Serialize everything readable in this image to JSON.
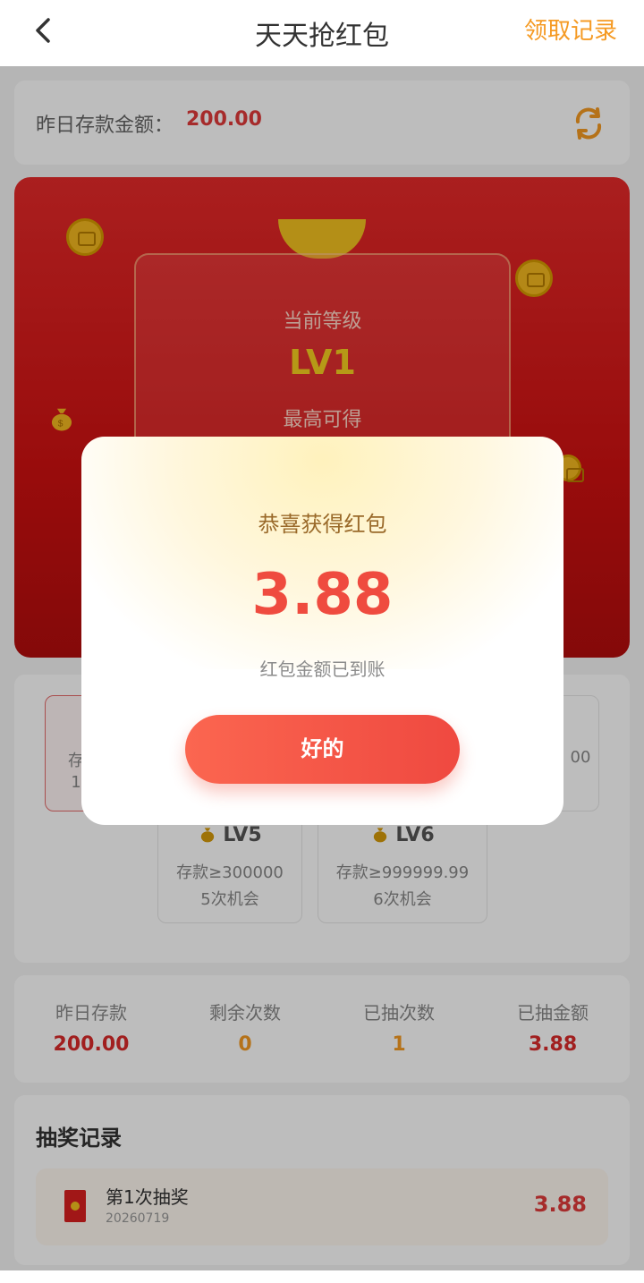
{
  "header": {
    "title": "天天抢红包",
    "record_link": "领取记录"
  },
  "deposit": {
    "label": "昨日存款金额：",
    "value": "200.00"
  },
  "current_level": {
    "caption": "当前等级",
    "value": "LV1",
    "max_label": "最高可得"
  },
  "levels": [
    {
      "name": "LV1",
      "line1": "存",
      "line2": "1"
    },
    {
      "name": "",
      "line1": "00",
      "line2": ""
    },
    {
      "name": "LV5",
      "line1": "存款≥300000",
      "line2": "5次机会"
    },
    {
      "name": "LV6",
      "line1": "存款≥999999.99",
      "line2": "6次机会"
    }
  ],
  "stats": [
    {
      "label": "昨日存款",
      "value": "200.00",
      "color": "#d92b2b"
    },
    {
      "label": "剩余次数",
      "value": "0",
      "color": "#f59a23"
    },
    {
      "label": "已抽次数",
      "value": "1",
      "color": "#f59a23"
    },
    {
      "label": "已抽金额",
      "value": "3.88",
      "color": "#d92b2b"
    }
  ],
  "records": {
    "title": "抽奖记录",
    "items": [
      {
        "title": "第1次抽奖",
        "date": "20260719",
        "amount": "3.88"
      }
    ]
  },
  "modal": {
    "title": "恭喜获得红包",
    "amount": "3.88",
    "note": "红包金额已到账",
    "button": "好的"
  }
}
